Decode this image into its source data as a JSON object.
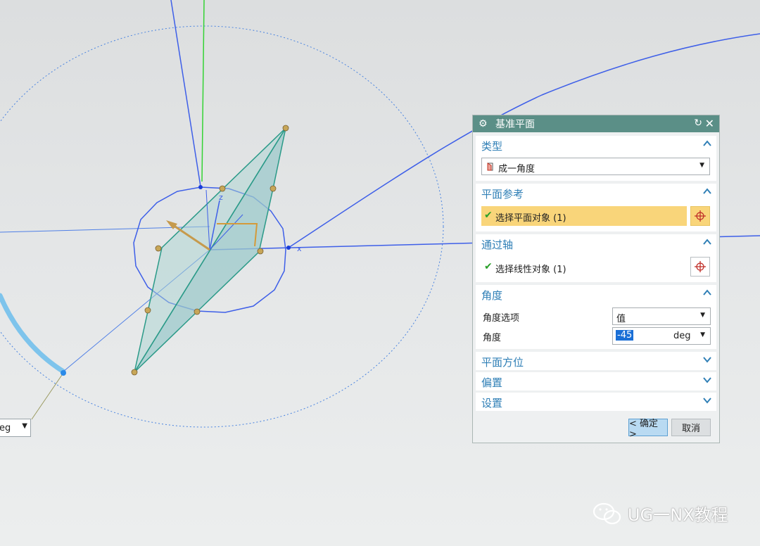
{
  "viewport": {
    "mini_field_value": "eg",
    "axis_label_x": "x",
    "axis_label_z": "z"
  },
  "dialog": {
    "title": "基准平面",
    "icons": {
      "title": "gear-icon",
      "reset": "reset-icon",
      "close": "close-icon"
    },
    "type_section": {
      "header": "类型",
      "value": "成一角度"
    },
    "plane_ref_section": {
      "header": "平面参考",
      "item": "选择平面对象 (1)"
    },
    "axis_section": {
      "header": "通过轴",
      "item": "选择线性对象 (1)"
    },
    "angle_section": {
      "header": "角度",
      "option_label": "角度选项",
      "option_value": "值",
      "angle_label": "角度",
      "angle_value": "-45",
      "angle_unit": "deg"
    },
    "orientation_section": {
      "header": "平面方位"
    },
    "offset_section": {
      "header": "偏置"
    },
    "settings_section": {
      "header": "设置"
    },
    "ok_label": "< 确定 >",
    "cancel_label": "取消"
  },
  "watermark": {
    "text": "UG一NX教程"
  },
  "colors": {
    "accent": "#2f7fb6",
    "title_bar": "#5b8f87",
    "highlight": "#f9d57a",
    "plane_fill": "#9ccacb"
  }
}
